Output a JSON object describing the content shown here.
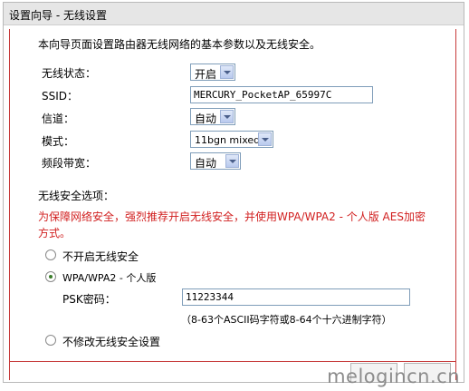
{
  "page": {
    "title": "设置向导 - 无线设置",
    "intro": "本向导页面设置路由器无线网络的基本参数以及无线安全。"
  },
  "wireless": {
    "status_label": "无线状态：",
    "status_value": "开启",
    "ssid_label": "SSID：",
    "ssid_value": "MERCURY_PocketAP_65997C",
    "channel_label": "信道：",
    "channel_value": "自动",
    "mode_label": "模式：",
    "mode_value": "11bgn mixed",
    "bandwidth_label": "频段带宽：",
    "bandwidth_value": "自动"
  },
  "security": {
    "section_label": "无线安全选项：",
    "warning_line1": "为保障网络安全，强烈推荐开启无线安全，并使用WPA/WPA2 - 个人版 AES加密",
    "warning_line2": "方式。",
    "option_disable": "不开启无线安全",
    "option_wpa": "WPA/WPA2 - 个人版",
    "psk_label": "PSK密码：",
    "psk_value": "11223344",
    "psk_hint": "（8-63个ASCII码字符或8-64个十六进制字符）",
    "option_keep": "不修改无线安全设置",
    "selected": "wpa"
  },
  "watermark": "melogincn.cn"
}
